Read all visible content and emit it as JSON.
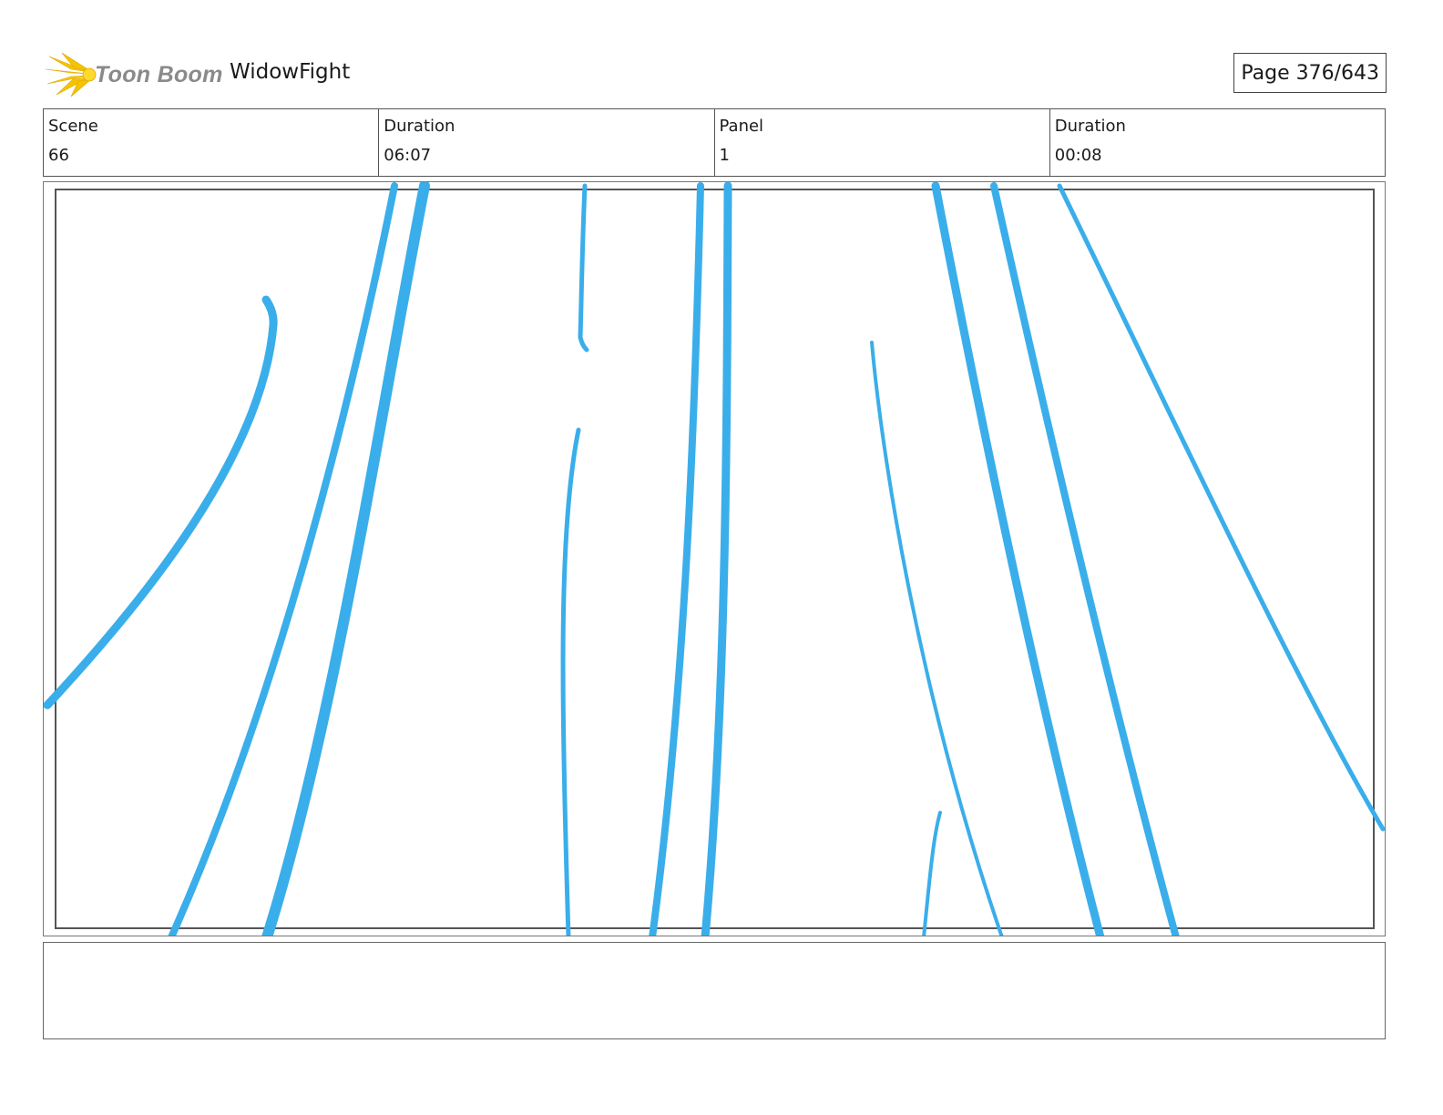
{
  "header": {
    "logo_text": "Toon Boom",
    "project_title": "WidowFight",
    "page_label": "Page 376/643"
  },
  "info": {
    "scene_label": "Scene",
    "scene_value": "66",
    "scene_duration_label": "Duration",
    "scene_duration_value": "06:07",
    "panel_label": "Panel",
    "panel_value": "1",
    "panel_duration_label": "Duration",
    "panel_duration_value": "00:08"
  },
  "colors": {
    "sketch_stroke": "#3aaeea",
    "logo_yellow": "#f5c400"
  },
  "notes": {
    "text": ""
  }
}
